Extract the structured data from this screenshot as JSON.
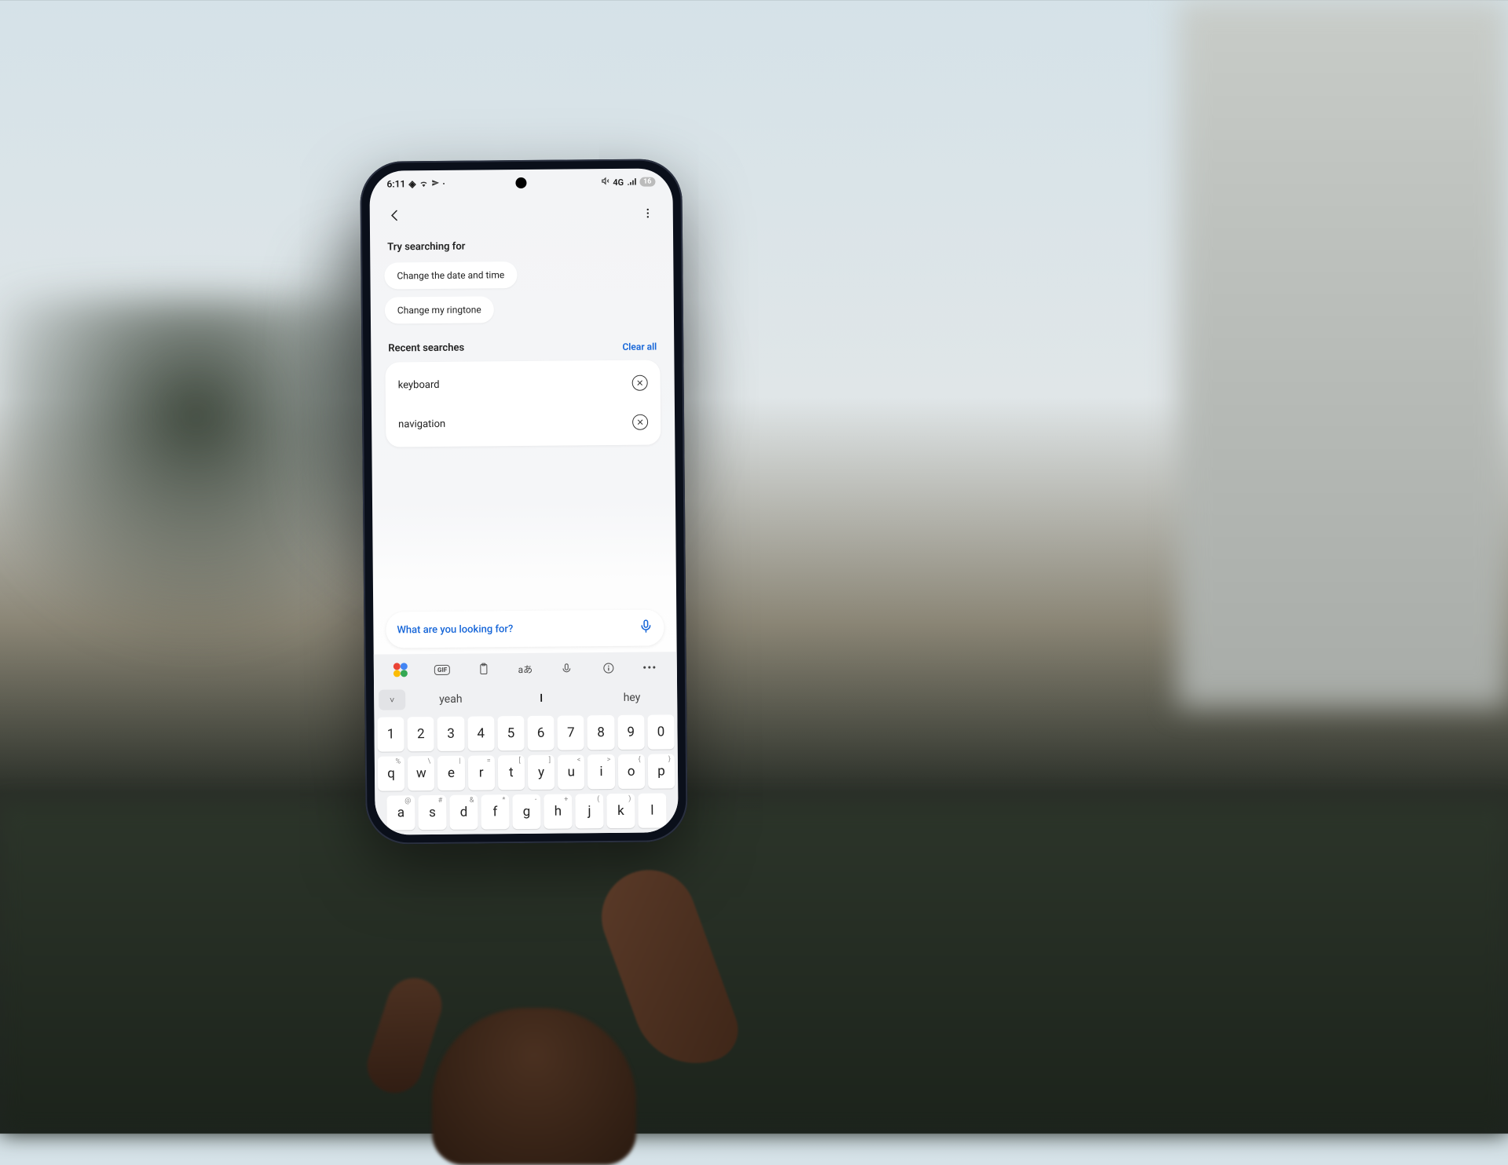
{
  "status": {
    "time": "6:11",
    "network": "4G",
    "battery": "16"
  },
  "suggestions": {
    "heading": "Try searching for",
    "items": [
      "Change the date and time",
      "Change my ringtone"
    ]
  },
  "recent": {
    "heading": "Recent searches",
    "clear_label": "Clear all",
    "items": [
      "keyboard",
      "navigation"
    ]
  },
  "search": {
    "placeholder": "What are you looking for?"
  },
  "keyboard": {
    "predictions": {
      "left": "yeah",
      "center": "I",
      "right": "hey"
    },
    "number_row": [
      "1",
      "2",
      "3",
      "4",
      "5",
      "6",
      "7",
      "8",
      "9",
      "0"
    ],
    "row1": [
      {
        "k": "q",
        "s": "%"
      },
      {
        "k": "w",
        "s": "\\"
      },
      {
        "k": "e",
        "s": "|"
      },
      {
        "k": "r",
        "s": "="
      },
      {
        "k": "t",
        "s": "["
      },
      {
        "k": "y",
        "s": "]"
      },
      {
        "k": "u",
        "s": "<"
      },
      {
        "k": "i",
        "s": ">"
      },
      {
        "k": "o",
        "s": "{"
      },
      {
        "k": "p",
        "s": "}"
      }
    ],
    "row2": [
      {
        "k": "a",
        "s": "@"
      },
      {
        "k": "s",
        "s": "#"
      },
      {
        "k": "d",
        "s": "&"
      },
      {
        "k": "f",
        "s": "*"
      },
      {
        "k": "g",
        "s": "-"
      },
      {
        "k": "h",
        "s": "+"
      },
      {
        "k": "j",
        "s": "("
      },
      {
        "k": "k",
        "s": ")"
      },
      {
        "k": "l",
        "s": ""
      }
    ],
    "toolbar_translate": "aあ"
  }
}
